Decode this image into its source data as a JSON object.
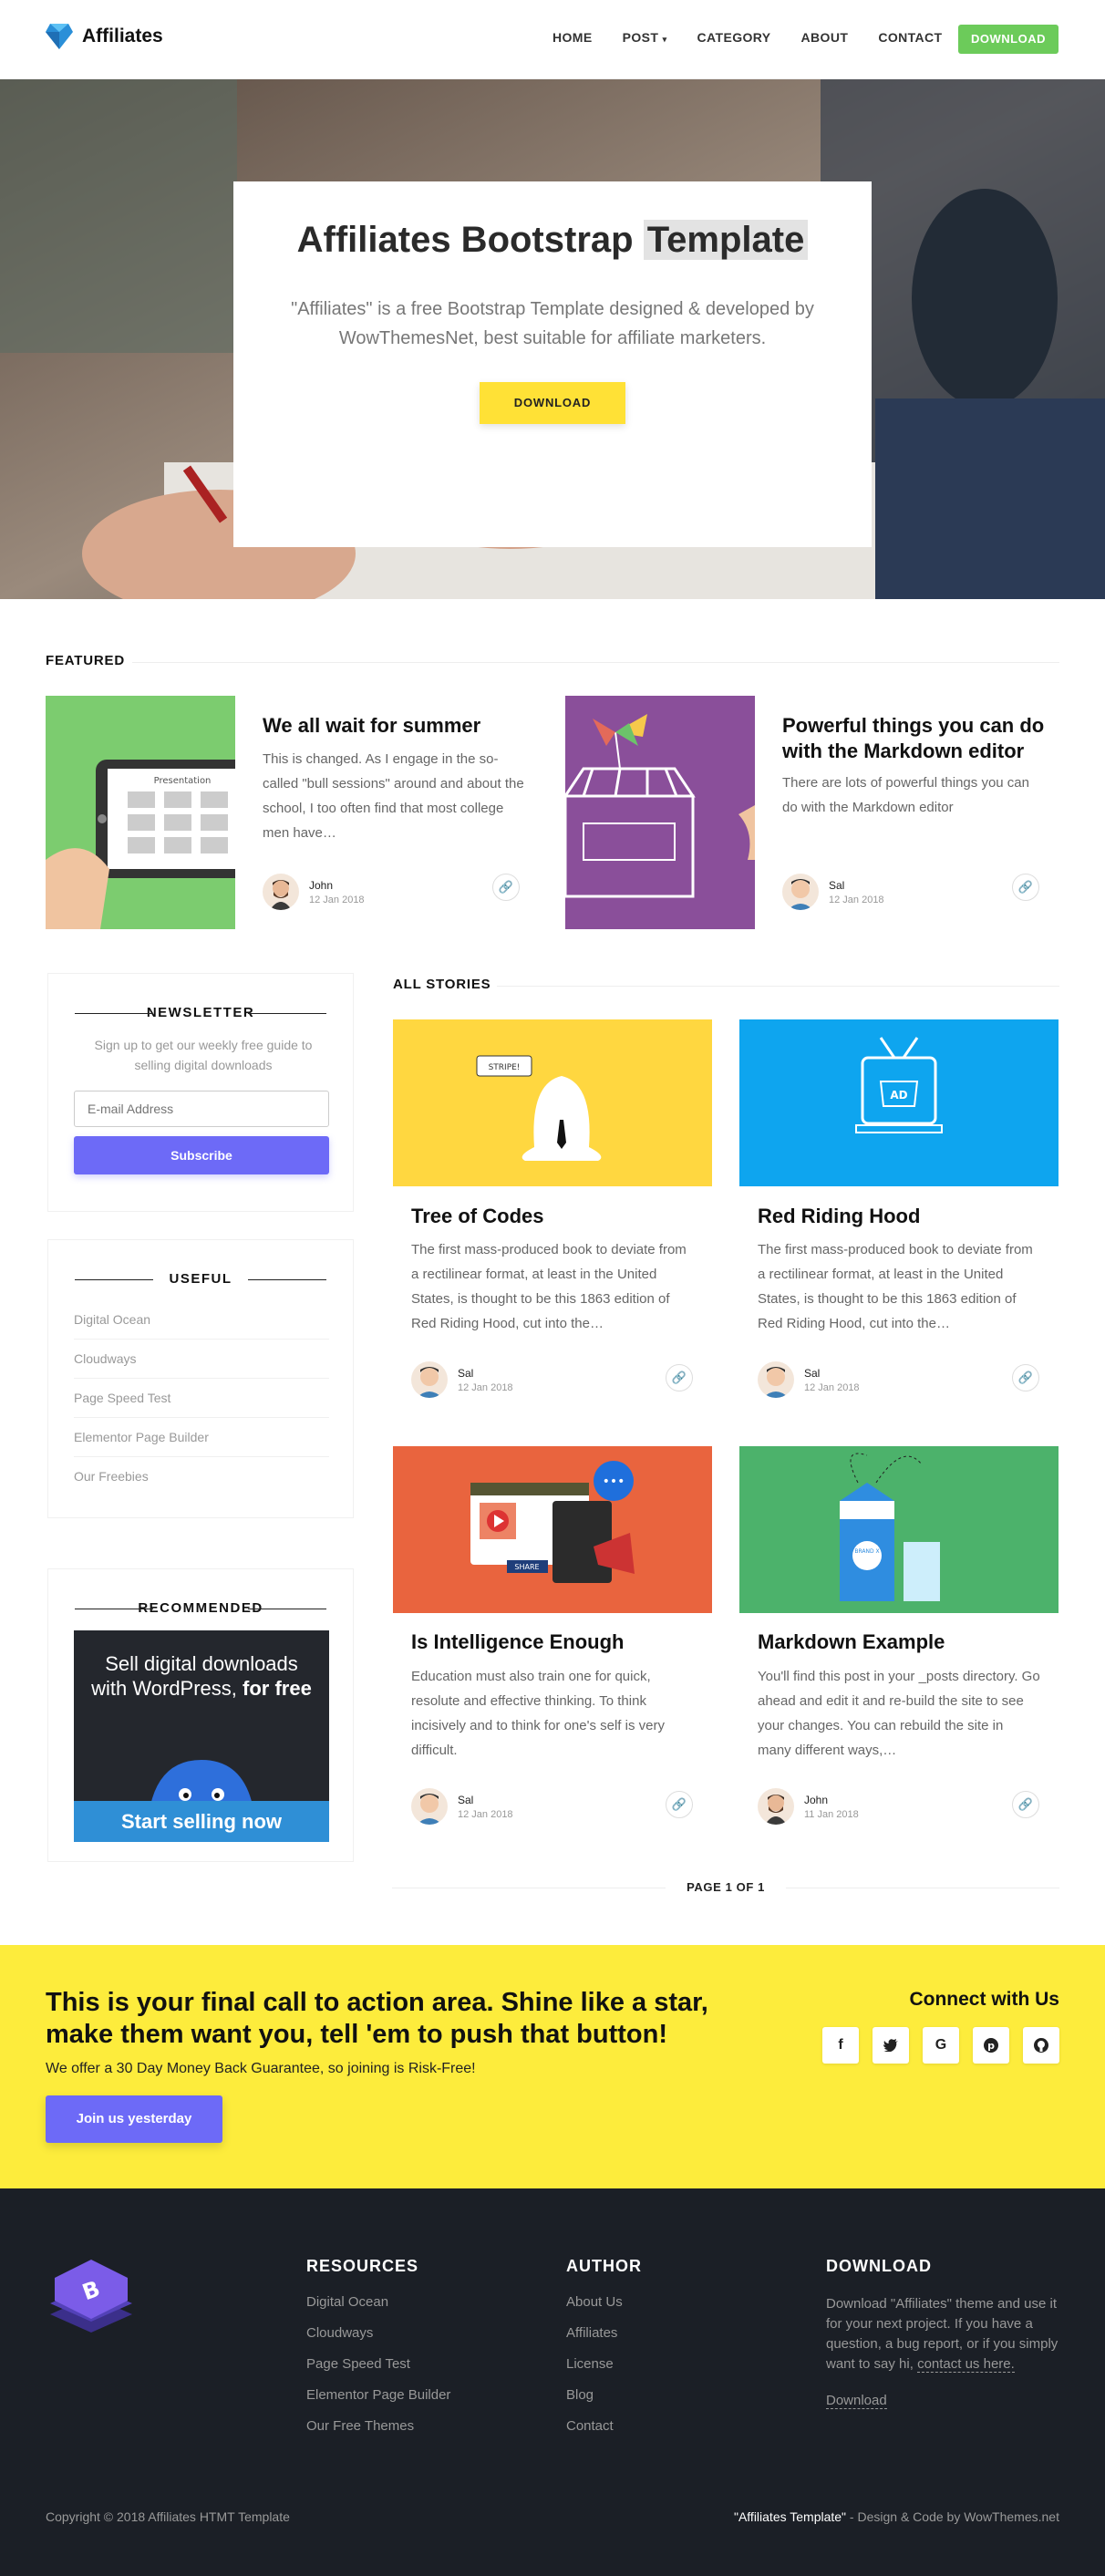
{
  "nav": {
    "brand": "Affiliates",
    "items": [
      "HOME",
      "POST",
      "CATEGORY",
      "ABOUT",
      "CONTACT"
    ],
    "download": "DOWNLOAD"
  },
  "hero": {
    "title_main": "Affiliates Bootstrap",
    "title_highlight": "Template",
    "text": "\"Affiliates\" is a free Bootstrap Template designed & developed by WowThemesNet, best suitable for affiliate marketers.",
    "button": "DOWNLOAD"
  },
  "featured": {
    "heading": "FEATURED",
    "posts": [
      {
        "title": "We all wait for summer",
        "excerpt": "This is changed. As I engage in the so-called \"bull sessions\" around and about the school, I too often find that most college men have…",
        "author": "John",
        "date": "12 Jan 2018",
        "image_label": "Presentation"
      },
      {
        "title": "Powerful things you can do with the Markdown editor",
        "excerpt": "There are lots of powerful things you can do with the Markdown editor",
        "author": "Sal",
        "date": "12 Jan 2018"
      }
    ]
  },
  "sidebar": {
    "newsletter": {
      "title": "NEWSLETTER",
      "text": "Sign up to get our weekly free guide to selling digital downloads",
      "placeholder": "E-mail Address",
      "button": "Subscribe"
    },
    "useful": {
      "title": "USEFUL",
      "items": [
        "Digital Ocean",
        "Cloudways",
        "Page Speed Test",
        "Elementor Page Builder",
        "Our Freebies"
      ]
    },
    "recommended": {
      "title": "RECOMMENDED",
      "ad_line1": "Sell digital downloads",
      "ad_line2": "with WordPress,",
      "ad_bold": "for free",
      "ad_button": "Start selling now"
    }
  },
  "stories": {
    "heading": "ALL STORIES",
    "posts": [
      {
        "title": "Tree of Codes",
        "excerpt": "The first mass-produced book to deviate from a rectilinear format, at least in the United States, is thought to be this 1863 edition of Red Riding Hood, cut into the…",
        "author": "Sal",
        "date": "12 Jan 2018",
        "image_label": "STRIPE!"
      },
      {
        "title": "Red Riding Hood",
        "excerpt": "The first mass-produced book to deviate from a rectilinear format, at least in the United States, is thought to be this 1863 edition of Red Riding Hood, cut into the…",
        "author": "Sal",
        "date": "12 Jan 2018",
        "image_label": "AD"
      },
      {
        "title": "Is Intelligence Enough",
        "excerpt": "Education must also train one for quick, resolute and effective thinking. To think incisively and to think for one's self is very difficult.",
        "author": "Sal",
        "date": "12 Jan 2018",
        "image_label": "SHARE"
      },
      {
        "title": "Markdown Example",
        "excerpt": "You'll find this post in your _posts directory. Go ahead and edit it and re-build the site to see your changes. You can rebuild the site in many different ways,…",
        "author": "John",
        "date": "11 Jan 2018",
        "image_label": "BRAND X"
      }
    ],
    "pager": "PAGE 1 OF 1"
  },
  "cta": {
    "title": "This is your final call to action area. Shine like a star, make them want you, tell 'em to push that button!",
    "text": "We offer a 30 Day Money Back Guarantee, so joining is Risk-Free!",
    "button": "Join us yesterday",
    "connect": "Connect with Us",
    "social": [
      "f",
      "twitter-icon",
      "G",
      "pinterest-icon",
      "github-icon"
    ]
  },
  "footer": {
    "resources": {
      "title": "RESOURCES",
      "items": [
        "Digital Ocean",
        "Cloudways",
        "Page Speed Test",
        "Elementor Page Builder",
        "Our Free Themes"
      ]
    },
    "author": {
      "title": "AUTHOR",
      "items": [
        "About Us",
        "Affiliates",
        "License",
        "Blog",
        "Contact"
      ]
    },
    "download": {
      "title": "DOWNLOAD",
      "text": "Download \"Affiliates\" theme and use it for your next project. If you have a question, a bug report, or if you simply want to say hi,",
      "contact_link": "contact us here.",
      "download_link": "Download"
    },
    "copyright": "Copyright © 2018 Affiliates HTMT Template",
    "credit_name": "\"Affiliates Template\"",
    "credit_rest": "- Design & Code by WowThemes.net"
  },
  "colors": {
    "accent": "#6d6af7",
    "yellow": "#fdec3c",
    "green": "#6ccb5a",
    "footer": "#1b1f26"
  }
}
